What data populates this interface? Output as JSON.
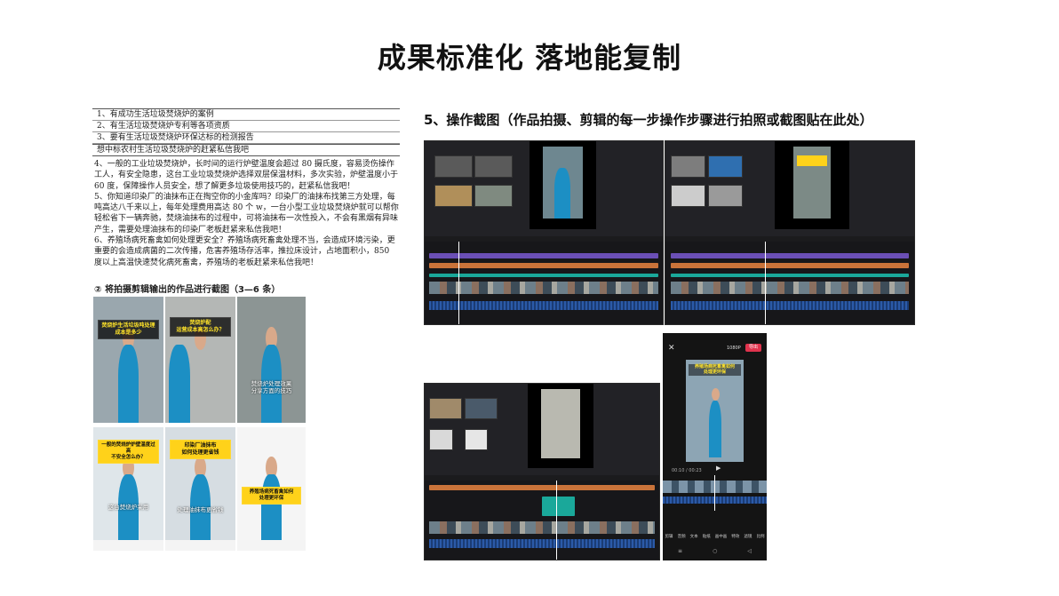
{
  "title": "成果标准化  落地能复制",
  "document": {
    "rows": [
      "1、有成功生活垃圾焚烧炉的案例",
      "2、有生活垃圾焚烧炉专利等各项资质",
      "3、要有生活垃圾焚烧炉环保达标的检测报告",
      "想中标农村生活垃圾焚烧炉的赶紧私信我吧"
    ],
    "paragraphs": [
      "4、一般的工业垃圾焚烧炉，长时间的运行炉壁温度会超过 80 摄氏度，容易烫伤操作工人，有安全隐患，这台工业垃圾焚烧炉选择双层保温材料，多次实验，炉壁温度小于 60 度，保障操作人员安全，想了解更多垃圾使用技巧的，赶紧私信我吧！",
      "5、你知道印染厂的油抹布正在掏空你的小金库吗？印染厂的油抹布找第三方处理，每吨高达八千来以上，每年处理费用高达 80 个 w，一台小型工业垃圾焚烧炉就可以帮你轻松省下一辆奔驰，焚烧油抹布的过程中，可将油抹布一次性投入，不会有黑烟有异味产生，需要处理油抹布的印染厂老板赶紧来私信我吧！",
      "6、养殖场病死畜禽如何处理更安全？养殖场病死畜禽处理不当，会造成环境污染，更重要的会造成病菌的二次传播，危害养殖场存活率，推拉床设计，占地面积小，850 度以上高温快速焚化病死畜禽，养殖场的老板赶紧来私信我吧！"
    ],
    "section_heading": "② 将拍摄剪辑输出的作品进行截图（3—6 条）"
  },
  "thumbnails": [
    {
      "caption": "焚烧炉生活垃圾吨处理\n成本是多少",
      "sub": ""
    },
    {
      "caption": "焚烧炉配\n运营成本高怎么办？",
      "sub": ""
    },
    {
      "caption": "",
      "sub": "焚烧炉处理效果\n分享方面的技巧"
    },
    {
      "caption": "一般的焚烧炉炉壁温度过高\n不安全怎么办？",
      "sub": "这台焚烧炉采用"
    },
    {
      "caption": "印染厂油抹布\n如何处理更省钱",
      "sub": "处理油抹布更省钱"
    },
    {
      "caption": "养殖场病死畜禽如何\n处理更环保",
      "sub": ""
    }
  ],
  "right_heading": "5、操作截图（作品拍摄、剪辑的每一步操作步骤进行拍照或截图贴在此处）",
  "phone": {
    "export_label": "导出",
    "resolution": "1080P",
    "overlay_caption": "养殖场病死畜禽如何\n处理更环保",
    "time": "00:10 / 00:23",
    "toolbar": [
      "剪辑",
      "音频",
      "文本",
      "贴纸",
      "画中画",
      "特效",
      "滤镜",
      "比例"
    ]
  },
  "colors": {
    "accent_purple": "#6b4fb6",
    "accent_orange": "#c9733a",
    "accent_teal": "#1aa89a"
  }
}
